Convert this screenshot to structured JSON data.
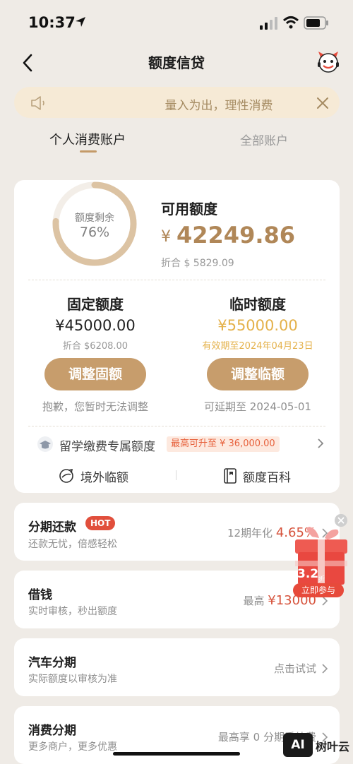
{
  "status_bar": {
    "time": "10:37"
  },
  "nav": {
    "title": "额度信贷"
  },
  "notice": {
    "text": "量入为出，理性消费"
  },
  "tabs": [
    {
      "label": "个人消费账户",
      "active": true
    },
    {
      "label": "全部账户",
      "active": false
    }
  ],
  "credit": {
    "ring_label": "额度剩余",
    "ring_value": "76%",
    "ring_fraction": 0.76,
    "available_title": "可用额度",
    "available_currency": "¥",
    "available_amount": "42249.86",
    "available_equiv": "折合 $ 5829.09"
  },
  "fixed": {
    "title": "固定额度",
    "amount": "¥45000.00",
    "equiv": "折合 $6208.00",
    "button": "调整固额",
    "note": "抱歉，您暂时无法调整"
  },
  "temporary": {
    "title": "临时额度",
    "amount": "¥55000.00",
    "valid": "有效期至2024年04月23日",
    "button": "调整临额",
    "note": "可延期至 2024-05-01"
  },
  "study": {
    "label": "留学缴费专属额度",
    "tag": "最高可升至 ¥ 36,000.00"
  },
  "quick_links": [
    {
      "label": "境外临额"
    },
    {
      "label": "额度百科"
    }
  ],
  "list": [
    {
      "title": "分期还款",
      "subtitle": "还款无忧，倍感轻松",
      "badge": "HOT",
      "right_prefix": "12期年化",
      "right_value": "4.65%"
    },
    {
      "title": "借钱",
      "subtitle": "实时审核，秒出额度",
      "right_prefix": "最高",
      "right_value": "¥13000"
    },
    {
      "title": "汽车分期",
      "subtitle": "实际额度以审核为准",
      "right_prefix": "点击试试",
      "right_value": ""
    },
    {
      "title": "消费分期",
      "subtitle": "更多商户，更多优惠",
      "right_prefix": "最高享 0 分期手续费",
      "right_value": ""
    }
  ],
  "promo": {
    "number": "3.2",
    "unit": "折",
    "button": "立即参与"
  },
  "watermark": {
    "badge": "AI",
    "text": "树叶云"
  },
  "colors": {
    "accent": "#c79d6c",
    "gold": "#b08758",
    "temp": "#e4b14a",
    "red": "#d6523b"
  }
}
